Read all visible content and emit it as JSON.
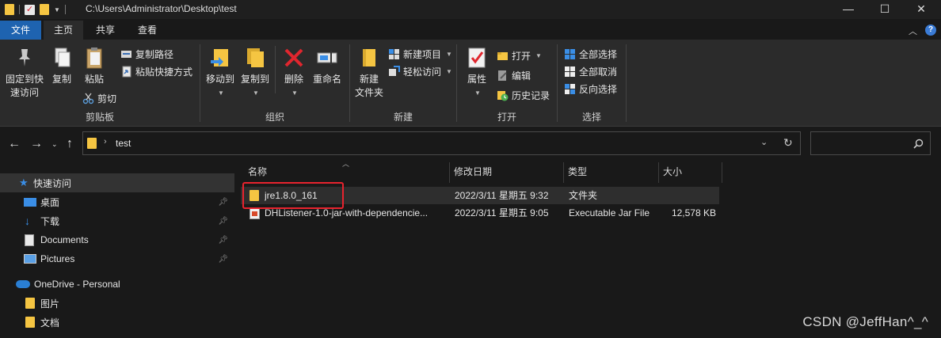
{
  "titlebar": {
    "path": "C:\\Users\\Administrator\\Desktop\\test",
    "minimize": "—",
    "maximize": "☐",
    "close": "✕"
  },
  "tabs": {
    "file": "文件",
    "home": "主页",
    "share": "共享",
    "view": "查看"
  },
  "ribbon": {
    "clipboard": {
      "label": "剪贴板",
      "pin_line1": "固定到快",
      "pin_line2": "速访问",
      "copy": "复制",
      "paste": "粘贴",
      "copy_path": "复制路径",
      "paste_shortcut": "粘贴快捷方式",
      "cut": "剪切"
    },
    "organize": {
      "label": "组织",
      "move_to": "移动到",
      "copy_to": "复制到",
      "delete": "删除",
      "rename": "重命名"
    },
    "new": {
      "label": "新建",
      "new_folder_line1": "新建",
      "new_folder_line2": "文件夹",
      "new_item": "新建项目",
      "easy_access": "轻松访问"
    },
    "open": {
      "label": "打开",
      "properties": "属性",
      "open": "打开",
      "edit": "编辑",
      "history": "历史记录"
    },
    "select": {
      "label": "选择",
      "select_all": "全部选择",
      "select_none": "全部取消",
      "invert": "反向选择"
    }
  },
  "address": {
    "crumb": "test"
  },
  "sidebar": {
    "items": [
      {
        "label": "快速访问",
        "icon": "star-icon"
      },
      {
        "label": "桌面",
        "icon": "desktop-icon",
        "pinned": true
      },
      {
        "label": "下载",
        "icon": "download-icon",
        "pinned": true
      },
      {
        "label": "Documents",
        "icon": "document-icon",
        "pinned": true
      },
      {
        "label": "Pictures",
        "icon": "pictures-icon",
        "pinned": true
      },
      {
        "label": "OneDrive - Personal",
        "icon": "cloud-icon"
      },
      {
        "label": "图片",
        "icon": "folder-icon"
      },
      {
        "label": "文档",
        "icon": "folder-icon"
      }
    ]
  },
  "columns": {
    "name": "名称",
    "modified": "修改日期",
    "type": "类型",
    "size": "大小"
  },
  "files": [
    {
      "name": "jre1.8.0_161",
      "modified": "2022/3/11 星期五 9:32",
      "type": "文件夹",
      "size": ""
    },
    {
      "name": "DHListener-1.0-jar-with-dependencie...",
      "modified": "2022/3/11 星期五 9:05",
      "type": "Executable Jar File",
      "size": "12,578 KB"
    }
  ],
  "watermark": "CSDN @JeffHan^_^",
  "colors": {
    "accent": "#1e63b0",
    "folder": "#f5c542",
    "highlight_box": "#e8232e"
  }
}
